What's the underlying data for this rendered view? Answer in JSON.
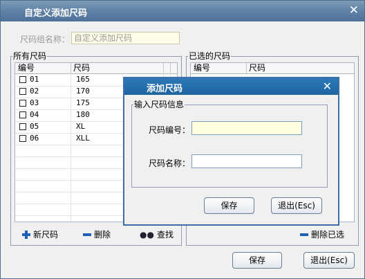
{
  "window": {
    "title": "自定义添加尺码",
    "close": "✕"
  },
  "group_name": {
    "label": "尺码组名称：",
    "value": "自定义添加尺码"
  },
  "all_sizes": {
    "title": "所有尺码",
    "columns": [
      "编号",
      "尺码"
    ],
    "rows": [
      {
        "code": "01",
        "name": "165"
      },
      {
        "code": "02",
        "name": "170"
      },
      {
        "code": "03",
        "name": "175"
      },
      {
        "code": "04",
        "name": "180"
      },
      {
        "code": "05",
        "name": "XL"
      },
      {
        "code": "06",
        "name": "XLL"
      }
    ],
    "toolbar": {
      "new": "新尺码",
      "delete": "删除",
      "find": "查找"
    }
  },
  "selected_sizes": {
    "title": "已选的尺码",
    "columns": [
      "编号",
      "尺码"
    ],
    "toolbar": {
      "remove": "删除已选"
    }
  },
  "footer": {
    "save": "保存",
    "exit": "退出(Esc)"
  },
  "dialog": {
    "title": "添加尺码",
    "close": "✕",
    "group_title": "输入尺码信息",
    "code_label": "尺码编号：",
    "name_label": "尺码名称：",
    "code_value": "",
    "name_value": "",
    "save": "保存",
    "exit": "退出(Esc)"
  }
}
